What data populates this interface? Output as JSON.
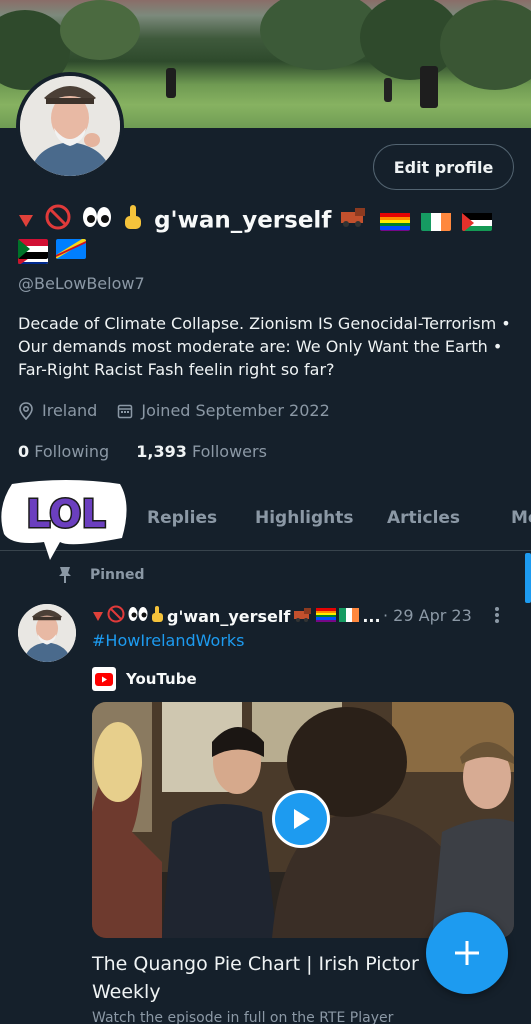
{
  "profile": {
    "edit_button": "Edit profile",
    "display_name": "g'wan_yerself",
    "handle": "@BeLowBelow7",
    "bio": "Decade of Climate Collapse. Zionism IS Genocidal-Terrorism • Our demands most moderate are: We Only Want the Earth • Far-Right Racist Fash feelin right so far?",
    "location": "Ireland",
    "joined": "Joined September 2022",
    "following_count": "0",
    "following_label": "Following",
    "followers_count": "1,393",
    "followers_label": "Followers"
  },
  "sticker": {
    "text": "LOL"
  },
  "tabs": [
    "Replies",
    "Highlights",
    "Articles",
    "Me"
  ],
  "pinned": {
    "label": "Pinned",
    "author": "g'wan_yerself",
    "ellipsis": "...",
    "date": "· 29 Apr 23",
    "hashtag": "#HowIrelandWorks",
    "source": "YouTube",
    "card_title": "The Quango Pie Chart | Irish Pictor Weekly",
    "card_desc": "Watch the episode in full on the RTE Player"
  },
  "colors": {
    "accent": "#1d9bf0",
    "bg": "#15202b",
    "muted": "#8b98a5"
  }
}
